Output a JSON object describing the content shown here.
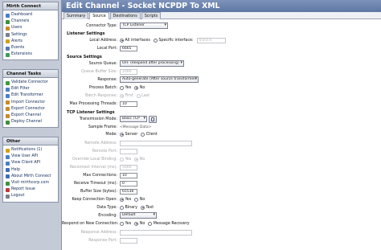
{
  "sidebar": {
    "connect": {
      "title": "Mirth Connect",
      "items": [
        {
          "label": "Dashboard",
          "icon": "dashboard-icon",
          "color": "#4a7fc4"
        },
        {
          "label": "Channels",
          "icon": "channels-icon",
          "color": "#3d8f3d"
        },
        {
          "label": "Users",
          "icon": "users-icon",
          "color": "#c48a2e"
        },
        {
          "label": "Settings",
          "icon": "settings-icon",
          "color": "#7a7f8c"
        },
        {
          "label": "Alerts",
          "icon": "alerts-icon",
          "color": "#d0a020"
        },
        {
          "label": "Events",
          "icon": "events-icon",
          "color": "#5a78b0"
        },
        {
          "label": "Extensions",
          "icon": "extensions-icon",
          "color": "#3f9a5a"
        }
      ]
    },
    "tasks": {
      "title": "Channel Tasks",
      "items": [
        {
          "label": "Validate Connector",
          "icon": "validate-icon",
          "color": "#3d9a3d"
        },
        {
          "label": "Edit Filter",
          "icon": "filter-icon",
          "color": "#4a7fc4"
        },
        {
          "label": "Edit Transformer",
          "icon": "transformer-icon",
          "color": "#4a7fc4"
        },
        {
          "label": "Import Connector",
          "icon": "import-icon",
          "color": "#c48a2e"
        },
        {
          "label": "Export Connector",
          "icon": "export-icon",
          "color": "#c48a2e"
        },
        {
          "label": "Export Channel",
          "icon": "export-channel-icon",
          "color": "#c48a2e"
        },
        {
          "label": "Deploy Channel",
          "icon": "deploy-icon",
          "color": "#3d8f3d"
        }
      ]
    },
    "other": {
      "title": "Other",
      "items": [
        {
          "label": "Notifications (1)",
          "icon": "notifications-icon",
          "color": "#d0a020"
        },
        {
          "label": "View User API",
          "icon": "user-api-icon",
          "color": "#4a7fc4"
        },
        {
          "label": "View Client API",
          "icon": "client-api-icon",
          "color": "#4a7fc4"
        },
        {
          "label": "Help",
          "icon": "help-icon",
          "color": "#3d6fb8"
        },
        {
          "label": "About Mirth Connect",
          "icon": "about-icon",
          "color": "#3d6fb8"
        },
        {
          "label": "Visit mirthcorp.com",
          "icon": "globe-icon",
          "color": "#3d8f3d"
        },
        {
          "label": "Report Issue",
          "icon": "report-icon",
          "color": "#b83d3d"
        },
        {
          "label": "Logout",
          "icon": "logout-icon",
          "color": "#7a7f8c"
        }
      ]
    }
  },
  "main": {
    "title": "Edit Channel - Socket NCPDP To XML",
    "tabs": [
      "Summary",
      "Source",
      "Destinations",
      "Scripts"
    ],
    "active_tab": "Source"
  },
  "form": {
    "connector_type_label": "Connector Type:",
    "connector_type_value": "TCP Listener",
    "listener_section": "Listener Settings",
    "local_address_label": "Local Address:",
    "local_address_all": "All interfaces",
    "local_address_specific": "Specific interface:",
    "local_address_value": "0.0.0.0",
    "local_port_label": "Local Port:",
    "local_port_value": "6665",
    "source_section": "Source Settings",
    "source_queue_label": "Source Queue:",
    "source_queue_value": "OFF (Respond after processing)",
    "queue_buffer_label": "Queue Buffer Size:",
    "queue_buffer_value": "1000",
    "response_label": "Response:",
    "response_value": "Auto-generate (After source transformer)",
    "process_batch_label": "Process Batch:",
    "yes": "Yes",
    "no": "No",
    "batch_response_label": "Batch Response:",
    "batch_first": "First",
    "batch_last": "Last",
    "max_threads_label": "Max Processing Threads:",
    "max_threads_value": "10",
    "tcp_section": "TCP Listener Settings",
    "transmission_mode_label": "Transmission Mode:",
    "transmission_mode_value": "Basic TCP",
    "sample_frame_label": "Sample Frame:",
    "sample_frame_value": "<Message Data>",
    "mode_label": "Mode:",
    "mode_server": "Server",
    "mode_client": "Client",
    "remote_address_label": "Remote Address:",
    "remote_port_label": "Remote Port:",
    "override_binding_label": "Override Local Binding:",
    "reconnect_interval_label": "Reconnect Interval (ms):",
    "reconnect_interval_value": "5000",
    "max_connections_label": "Max Connections:",
    "max_connections_value": "10",
    "receive_timeout_label": "Receive Timeout (ms):",
    "receive_timeout_value": "0",
    "buffer_size_label": "Buffer Size (bytes):",
    "buffer_size_value": "65536",
    "keep_open_label": "Keep Connection Open:",
    "data_type_label": "Data Type:",
    "data_binary": "Binary",
    "data_text": "Text",
    "encoding_label": "Encoding:",
    "encoding_value": "Default",
    "respond_new_label": "Respond on New Connection:",
    "message_recovery": "Message Recovery",
    "response_address_label": "Response Address:",
    "response_port_label": "Response Port:"
  }
}
